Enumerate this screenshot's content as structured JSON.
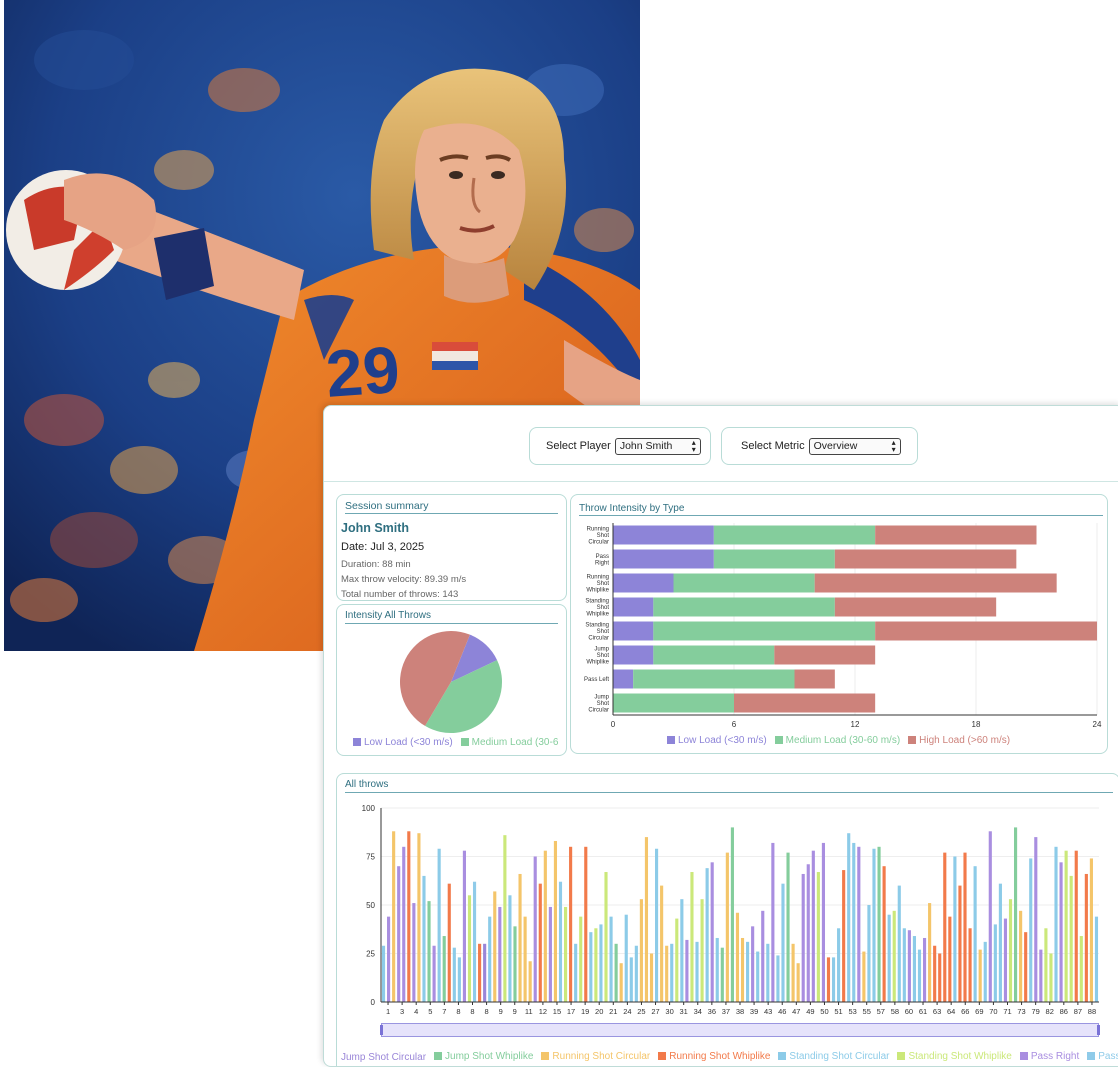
{
  "controls": {
    "player_label": "Select Player",
    "player_value": "John Smith",
    "metric_label": "Select Metric",
    "metric_value": "Overview"
  },
  "summary": {
    "title": "Session summary",
    "player_name": "John Smith",
    "date": "Date: Jul 3, 2025",
    "duration": "Duration: 88 min",
    "max_velocity": "Max throw velocity: 89.39 m/s",
    "total_throws": "Total number of throws: 143"
  },
  "colors": {
    "low": "#8d84d8",
    "medium": "#84cd9c",
    "high": "#cd827b",
    "jump_shot_circular": "#9a86d8",
    "jump_shot_whiplike": "#84cd9c",
    "running_shot_circular": "#f4c56a",
    "running_shot_whiplike": "#f27a4a",
    "standing_shot_circular": "#8ccbe8",
    "standing_shot_whiplike": "#cbe87a",
    "pass_right": "#a98ee0",
    "pass_left": "#8fcbe9",
    "axis_title": "#2f6f80"
  },
  "chart_data": [
    {
      "type": "pie",
      "title": "Intensity All Throws",
      "labels": [
        "Low Load (<30 m/s)",
        "Medium Load (30-60 m/s)",
        "High Load (>60 m/s)"
      ],
      "legend_visible": [
        "Low Load (<30 m/s)",
        "Medium Load (30-6"
      ],
      "values": [
        17,
        58,
        68
      ]
    },
    {
      "type": "bar",
      "orientation": "horizontal",
      "stacked": true,
      "title": "Throw Intensity by Type",
      "categories": [
        "Running Shot Circular",
        "Pass Right",
        "Running Shot Whiplike",
        "Standing Shot Whiplike",
        "Standing Shot Circular",
        "Jump Shot Whiplike",
        "Pass Left",
        "Jump Shot Circular"
      ],
      "series": [
        {
          "name": "Low Load (<30 m/s)",
          "values": [
            5,
            5,
            3,
            2,
            2,
            2,
            1,
            0
          ]
        },
        {
          "name": "Medium Load (30-60 m/s)",
          "values": [
            8,
            6,
            7,
            9,
            11,
            6,
            8,
            6
          ]
        },
        {
          "name": "High Load (>60 m/s)",
          "values": [
            8,
            9,
            12,
            8,
            11,
            5,
            2,
            7
          ]
        }
      ],
      "xlim": [
        0,
        24
      ],
      "xticks": [
        "0",
        "6",
        "12",
        "18",
        "24"
      ],
      "legend": "bottom"
    },
    {
      "type": "bar",
      "title": "All throws",
      "ylim": [
        0,
        100
      ],
      "yticks": [
        "0",
        "25",
        "50",
        "75",
        "100"
      ],
      "xticks": [
        "1",
        "3",
        "4",
        "5",
        "7",
        "8",
        "8",
        "8",
        "9",
        "9",
        "11",
        "12",
        "15",
        "17",
        "19",
        "20",
        "21",
        "24",
        "25",
        "27",
        "30",
        "31",
        "34",
        "36",
        "37",
        "38",
        "39",
        "43",
        "46",
        "47",
        "49",
        "50",
        "51",
        "53",
        "55",
        "57",
        "58",
        "60",
        "61",
        "63",
        "64",
        "66",
        "69",
        "70",
        "71",
        "73",
        "79",
        "82",
        "86",
        "87",
        "88"
      ],
      "types": [
        "Jump Shot Circular",
        "Jump Shot Whiplike",
        "Running Shot Circular",
        "Running Shot Whiplike",
        "Standing Shot Circular",
        "Standing Shot Whiplike",
        "Pass Right",
        "Pass Left"
      ],
      "legend_visible": [
        "Jump Shot Circular",
        "Jump Shot Whiplike",
        "Running Shot Circular",
        "Running Shot Whiplike",
        "Standing Shot Circular",
        "Standing Shot Whiplike",
        "Pass Right",
        "Pass Le"
      ],
      "values": [
        29,
        44,
        88,
        70,
        80,
        88,
        51,
        87,
        65,
        52,
        29,
        79,
        34,
        61,
        28,
        23,
        78,
        55,
        62,
        30,
        30,
        44,
        57,
        49,
        86,
        55,
        39,
        66,
        44,
        21,
        75,
        61,
        78,
        49,
        83,
        62,
        49,
        80,
        30,
        44,
        80,
        36,
        38,
        40,
        67,
        44,
        30,
        20,
        45,
        23,
        29,
        53,
        85,
        25,
        79,
        60,
        29,
        30,
        43,
        53,
        32,
        67,
        31,
        53,
        69,
        72,
        33,
        28,
        77,
        90,
        46,
        33,
        31,
        39,
        26,
        47,
        30,
        82,
        24,
        61,
        77,
        30,
        20,
        66,
        71,
        78,
        67,
        82,
        23,
        23,
        38,
        68,
        87,
        82,
        80,
        26,
        50,
        79,
        80,
        70,
        45,
        47,
        60,
        38,
        37,
        34,
        27,
        33,
        51,
        29,
        25,
        77,
        44,
        75,
        60,
        77,
        38,
        70,
        27,
        31,
        88,
        40,
        61,
        43,
        53,
        90,
        47,
        36,
        74,
        85,
        27,
        38,
        25,
        80,
        72,
        78,
        65,
        78,
        34,
        66,
        74,
        44
      ],
      "series_index": [
        4,
        6,
        2,
        6,
        6,
        3,
        6,
        2,
        4,
        1,
        6,
        4,
        1,
        3,
        4,
        4,
        6,
        5,
        7,
        3,
        0,
        4,
        2,
        6,
        5,
        4,
        1,
        2,
        2,
        2,
        6,
        3,
        2,
        6,
        2,
        7,
        5,
        3,
        4,
        5,
        3,
        4,
        5,
        4,
        5,
        4,
        1,
        2,
        4,
        4,
        4,
        2,
        2,
        2,
        4,
        2,
        2,
        4,
        5,
        4,
        6,
        5,
        4,
        5,
        4,
        6,
        4,
        1,
        2,
        1,
        2,
        2,
        4,
        6,
        4,
        6,
        4,
        6,
        4,
        4,
        1,
        2,
        2,
        6,
        6,
        6,
        5,
        6,
        3,
        4,
        4,
        3,
        4,
        4,
        6,
        2,
        4,
        4,
        1,
        3,
        4,
        5,
        4,
        4,
        6,
        4,
        4,
        6,
        2,
        3,
        3,
        3,
        3,
        4,
        3,
        3,
        3,
        4,
        2,
        4,
        6,
        4,
        4,
        6,
        5,
        1,
        2,
        3,
        4,
        6,
        6,
        5,
        5,
        4,
        6,
        5,
        5,
        3,
        5,
        3,
        2,
        4,
        3
      ]
    }
  ],
  "throws_panel": {
    "title": "All throws"
  }
}
